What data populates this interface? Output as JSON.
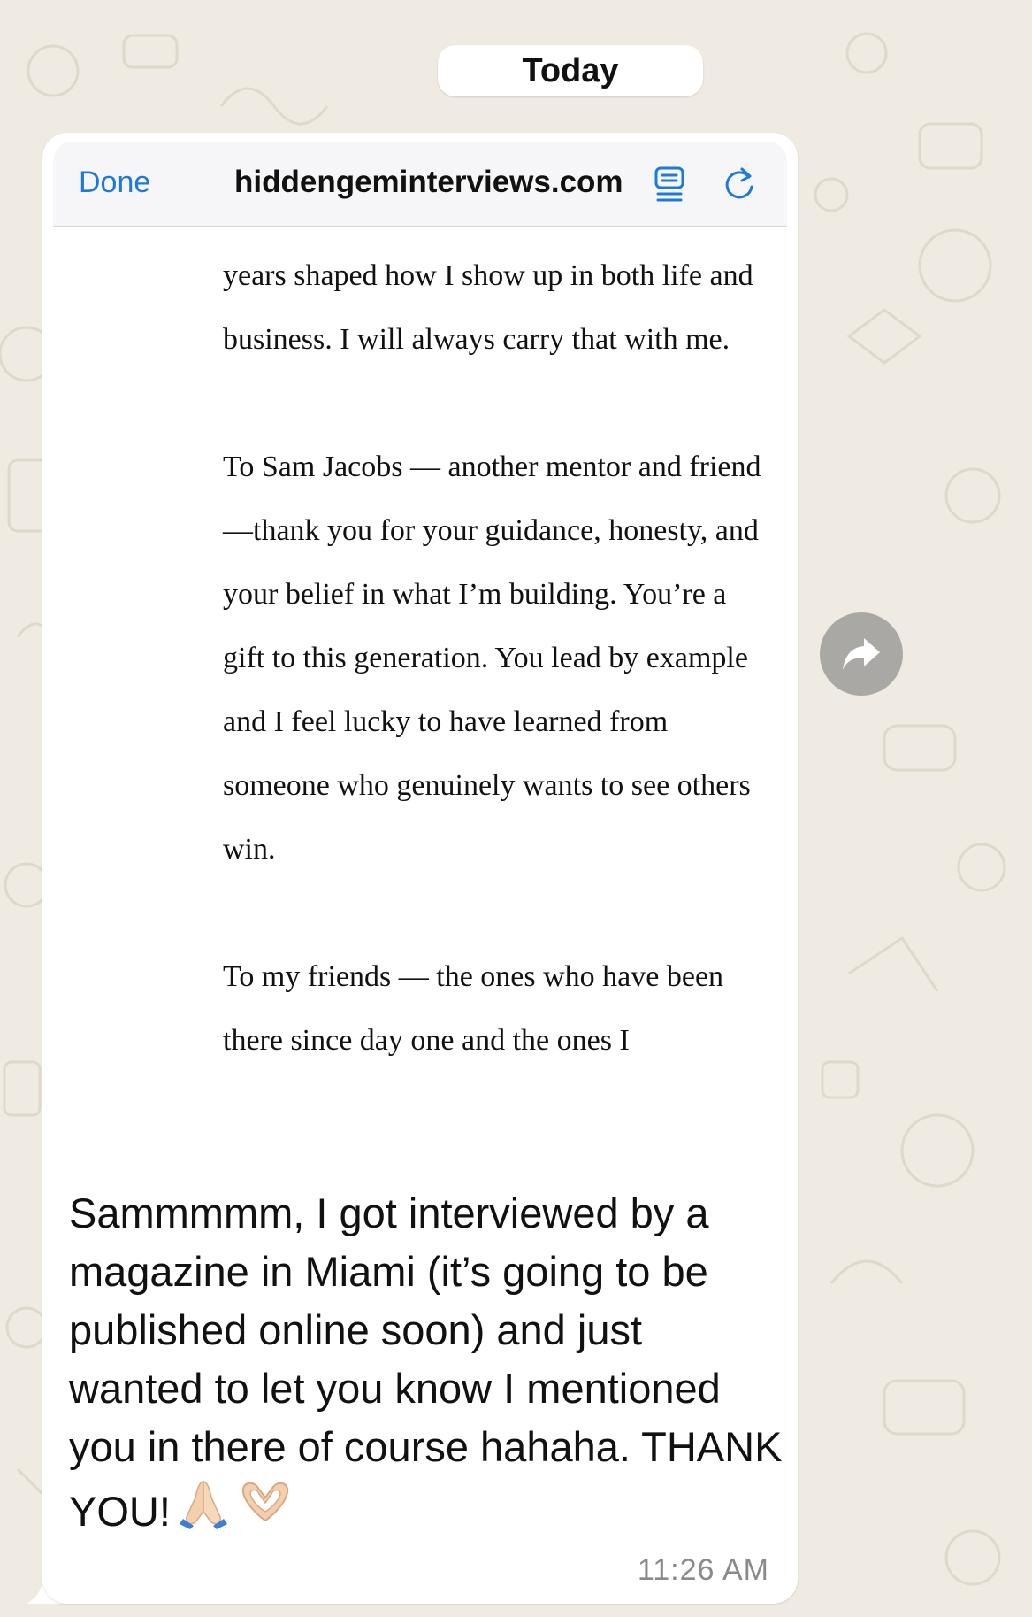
{
  "chat": {
    "date_label": "Today"
  },
  "browser": {
    "done_label": "Done",
    "url": "hiddengeminterviews.com",
    "reader_icon": "reader-view-icon",
    "reload_icon": "reload-icon"
  },
  "article": {
    "paragraphs": [
      "years shaped how I show up in both life and business. I will always carry that with me.",
      "To Sam Jacobs  — another mentor and friend—thank you for your guidance, honesty, and your belief in what I’m building. You’re a gift to this generation. You lead by example and I feel lucky to have learned from someone who genuinely wants to see others win.",
      "To my friends — the ones who have been there since day one and the ones I"
    ]
  },
  "message": {
    "text": "Sammmmm, I got interviewed by a magazine in Miami (it’s going to be published online soon) and just wanted to let you know I mentioned you in there of course hahaha. THANK YOU!",
    "emojis": [
      "folded-hands-emoji",
      "heart-hands-emoji"
    ],
    "time": "11:26 AM"
  },
  "actions": {
    "forward_icon": "forward-arrow-icon"
  },
  "colors": {
    "wallpaper": "#efeae2",
    "bubble": "#ffffff",
    "link_blue": "#1e7ad8",
    "timestamp": "#8a8a8a",
    "forward_button": "#a9a8a5"
  }
}
